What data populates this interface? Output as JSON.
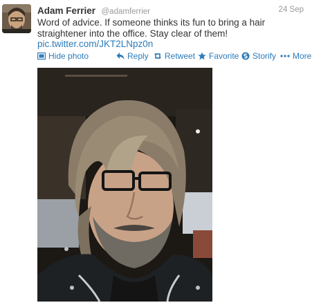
{
  "tweet": {
    "author_name": "Adam Ferrier",
    "author_handle": "@adamferrier",
    "date": "24 Sep",
    "text": "Word of advice. If someone thinks its fun to bring a hair\nstraightener into the office. Stay clear of  them!",
    "link": "pic.twitter.com/JKT2LNpz0n"
  },
  "actions": {
    "hide_photo": "Hide photo",
    "reply": "Reply",
    "retweet": "Retweet",
    "favorite": "Favorite",
    "storify": "Storify",
    "more": "More"
  },
  "colors": {
    "link": "#2b7bb9",
    "text": "#333333",
    "meta": "#999999"
  },
  "icons": [
    "photo-icon",
    "reply-icon",
    "retweet-icon",
    "star-icon",
    "storify-icon",
    "more-dots-icon"
  ]
}
